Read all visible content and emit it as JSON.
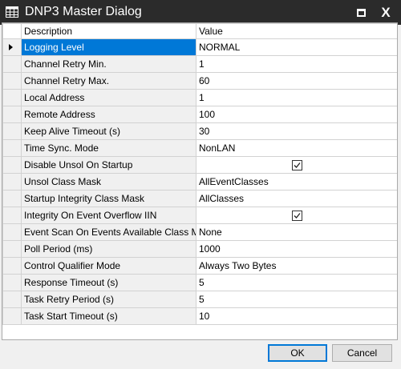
{
  "window": {
    "title": "DNP3 Master Dialog",
    "icon": "grid-app-icon",
    "maximize_icon": "maximize-icon",
    "close_label": "X"
  },
  "grid": {
    "columns": [
      "Description",
      "Value"
    ],
    "rows": [
      {
        "label": "Logging Level",
        "value": "NORMAL",
        "selected": true
      },
      {
        "label": "Channel Retry Min.",
        "value": "1"
      },
      {
        "label": "Channel Retry Max.",
        "value": "60"
      },
      {
        "label": "Local Address",
        "value": "1"
      },
      {
        "label": "Remote Address",
        "value": "100"
      },
      {
        "label": "Keep Alive Timeout (s)",
        "value": "30"
      },
      {
        "label": "Time Sync. Mode",
        "value": "NonLAN"
      },
      {
        "label": "Disable Unsol On Startup",
        "checked": true
      },
      {
        "label": "Unsol Class Mask",
        "value": "AllEventClasses"
      },
      {
        "label": "Startup Integrity Class Mask",
        "value": "AllClasses"
      },
      {
        "label": "Integrity On Event Overflow IIN",
        "checked": true
      },
      {
        "label": "Event Scan On Events Available Class Mask",
        "value": "None"
      },
      {
        "label": "Poll Period (ms)",
        "value": "1000"
      },
      {
        "label": "Control Qualifier Mode",
        "value": "Always Two Bytes"
      },
      {
        "label": "Response Timeout (s)",
        "value": "5"
      },
      {
        "label": "Task Retry Period (s)",
        "value": "5"
      },
      {
        "label": "Task Start Timeout (s)",
        "value": "10"
      }
    ]
  },
  "buttons": {
    "ok": "OK",
    "cancel": "Cancel"
  },
  "colors": {
    "titlebar": "#2b2b2b",
    "selection": "#0078d7"
  }
}
